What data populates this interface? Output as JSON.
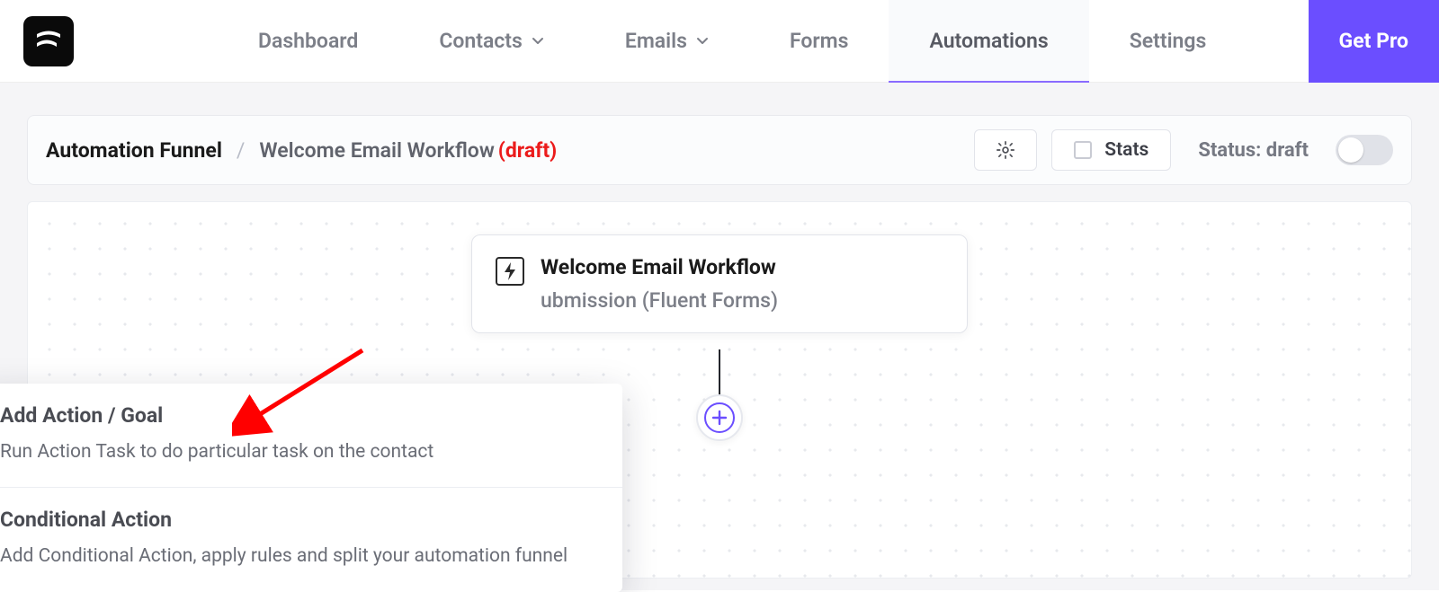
{
  "nav": {
    "items": [
      {
        "label": "Dashboard",
        "hasChevron": false
      },
      {
        "label": "Contacts",
        "hasChevron": true
      },
      {
        "label": "Emails",
        "hasChevron": true
      },
      {
        "label": "Forms",
        "hasChevron": false
      },
      {
        "label": "Automations",
        "hasChevron": false
      },
      {
        "label": "Settings",
        "hasChevron": false
      }
    ],
    "getpro_label": "Get Pro"
  },
  "breadcrumb": {
    "title": "Automation Funnel",
    "separator": "/",
    "workflow_name": "Welcome Email Workflow",
    "draft_label": "(draft)"
  },
  "toolbar": {
    "stats_label": "Stats",
    "status_label": "Status: draft"
  },
  "trigger": {
    "title": "Welcome Email Workflow",
    "subtitle": "ubmission (Fluent Forms)"
  },
  "flyout": {
    "items": [
      {
        "title": "Add Action / Goal",
        "desc": "Run Action Task to do particular task on the contact"
      },
      {
        "title": "Conditional Action",
        "desc": "Add Conditional Action, apply rules and split your automation funnel"
      }
    ]
  }
}
